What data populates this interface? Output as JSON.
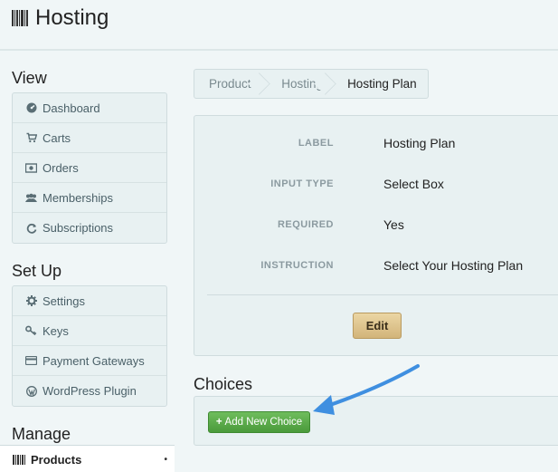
{
  "header": {
    "title": "Hosting",
    "icon": "barcode-icon"
  },
  "sidebar": {
    "view": {
      "title": "View",
      "items": [
        {
          "label": "Dashboard",
          "icon": "dashboard-icon"
        },
        {
          "label": "Carts",
          "icon": "cart-icon"
        },
        {
          "label": "Orders",
          "icon": "money-icon"
        },
        {
          "label": "Memberships",
          "icon": "group-icon"
        },
        {
          "label": "Subscriptions",
          "icon": "refresh-icon"
        }
      ]
    },
    "setup": {
      "title": "Set Up",
      "items": [
        {
          "label": "Settings",
          "icon": "gear-icon"
        },
        {
          "label": "Keys",
          "icon": "key-icon"
        },
        {
          "label": "Payment Gateways",
          "icon": "credit-card-icon"
        },
        {
          "label": "WordPress Plugin",
          "icon": "wordpress-icon"
        }
      ]
    },
    "manage": {
      "title": "Manage",
      "active_item": {
        "label": "Products",
        "icon": "barcode-icon"
      }
    }
  },
  "breadcrumb": [
    "Products",
    "Hosting",
    "Hosting Plan"
  ],
  "details": {
    "fields": [
      {
        "label": "LABEL",
        "value": "Hosting Plan"
      },
      {
        "label": "INPUT TYPE",
        "value": "Select Box"
      },
      {
        "label": "REQUIRED",
        "value": "Yes"
      },
      {
        "label": "INSTRUCTION",
        "value": "Select Your Hosting Plan"
      }
    ],
    "edit_label": "Edit"
  },
  "choices": {
    "title": "Choices",
    "add_label": "Add New Choice"
  },
  "colors": {
    "background": "#f0f6f7",
    "panel": "#e8f1f2",
    "edit_button": "#d2b47a",
    "add_button": "#4a9a3b",
    "annotation_arrow": "#3f8fe0"
  }
}
